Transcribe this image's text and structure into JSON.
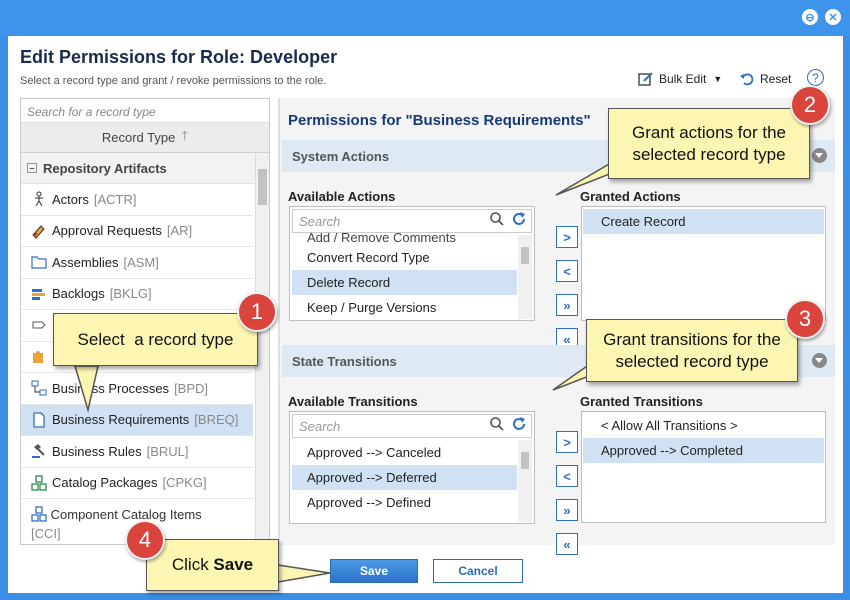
{
  "dialog": {
    "title": "Edit Permissions for Role: Developer",
    "subtitle": "Select a record type and grant / revoke permissions to the role.",
    "bulk_edit": "Bulk Edit",
    "reset": "Reset",
    "help": "?"
  },
  "record_types": {
    "search_placeholder": "Search for a record type",
    "column_header": "Record Type",
    "group": "Repository Artifacts",
    "items": [
      {
        "name": "Actors",
        "tag": "[ACTR]"
      },
      {
        "name": "Approval Requests",
        "tag": "[AR]"
      },
      {
        "name": "Assemblies",
        "tag": "[ASM]"
      },
      {
        "name": "Backlogs",
        "tag": "[BKLG]"
      },
      {
        "name": "Business Processes",
        "tag": "[BPD]"
      },
      {
        "name": "Business Requirements",
        "tag": "[BREQ]",
        "selected": true
      },
      {
        "name": "Business Rules",
        "tag": "[BRUL]"
      },
      {
        "name": "Catalog Packages",
        "tag": "[CPKG]"
      },
      {
        "name": "Component Catalog Items",
        "tag": "[CCI]"
      }
    ]
  },
  "permissions": {
    "title": "Permissions for \"Business Requirements\"",
    "actions_section": "System Actions",
    "available_actions_label": "Available Actions",
    "granted_actions_label": "Granted Actions",
    "actions_search": "Search",
    "available_actions": [
      {
        "label": "Add / Remove Comments"
      },
      {
        "label": "Convert Record Type"
      },
      {
        "label": "Delete Record",
        "selected": true
      },
      {
        "label": "Keep / Purge Versions"
      }
    ],
    "granted_actions": [
      {
        "label": "Create Record",
        "selected": true
      }
    ],
    "transitions_section": "State Transitions",
    "available_transitions_label": "Available Transitions",
    "granted_transitions_label": "Granted Transitions",
    "transitions_search": "Search",
    "available_transitions": [
      {
        "label": "Approved --> Canceled"
      },
      {
        "label": "Approved --> Deferred",
        "selected": true
      },
      {
        "label": "Approved --> Defined"
      }
    ],
    "granted_transitions": [
      {
        "label": "< Allow All Transitions >"
      },
      {
        "label": "Approved --> Completed",
        "selected": true
      }
    ]
  },
  "buttons": {
    "save": "Save",
    "cancel": "Cancel"
  },
  "callouts": {
    "step1": {
      "number": "1",
      "text": "Select  a record type"
    },
    "step2": {
      "number": "2",
      "text_line1": "Grant actions for the",
      "text_line2": "selected record type"
    },
    "step3": {
      "number": "3",
      "text_line1": "Grant transitions for the",
      "text_line2": "selected record type"
    },
    "step4": {
      "number": "4",
      "text_prefix": "Click ",
      "text_bold": "Save"
    }
  },
  "colors": {
    "frame": "#3d94ea",
    "title": "#1b2b4d",
    "accent": "#2e6fc4",
    "selected_row": "#cfe1f3",
    "callout_bg": "#fdf6b3",
    "callout_number": "#d9453c"
  }
}
